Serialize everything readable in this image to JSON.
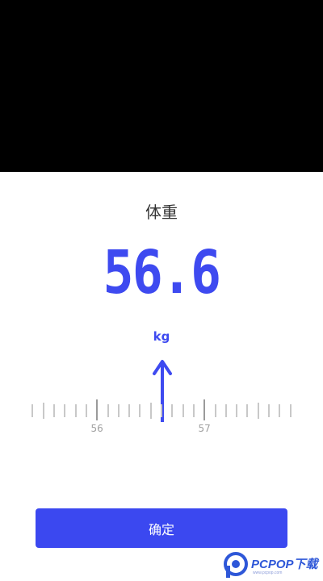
{
  "sheet": {
    "title": "体重",
    "value": "56.6",
    "unit": "kg"
  },
  "ruler": {
    "selected_value": 56.6,
    "labels": [
      "56",
      "57"
    ]
  },
  "actions": {
    "confirm_label": "确定"
  },
  "watermark": {
    "brand_text": "PCPOP下载"
  },
  "colors": {
    "accent": "#3e4af0",
    "button": "#3b48f0",
    "tick": "#c8c8c8"
  },
  "icons": {
    "pointer": "arrow-up-icon"
  }
}
